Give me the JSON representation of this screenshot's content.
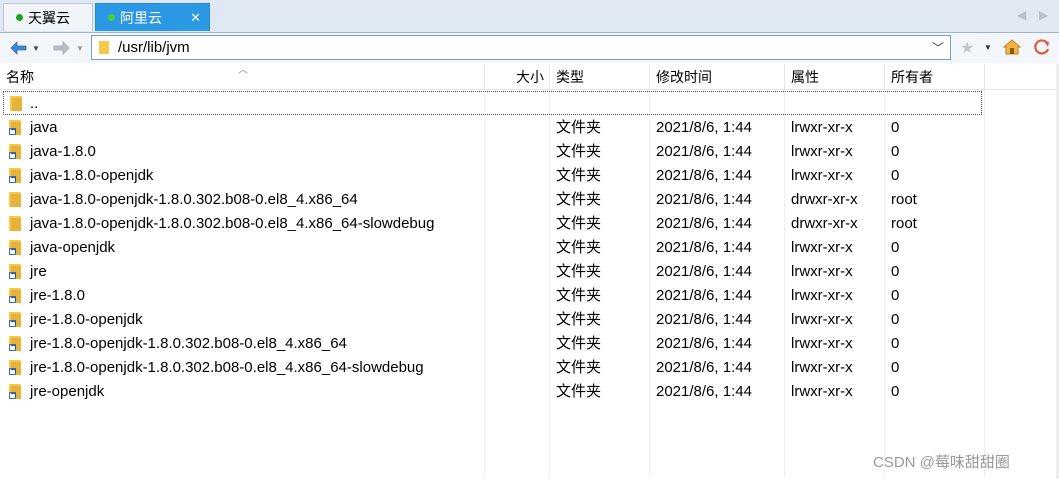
{
  "tabs": [
    {
      "label": "天翼云",
      "active": false
    },
    {
      "label": "阿里云",
      "active": true
    }
  ],
  "address": {
    "path": "/usr/lib/jvm"
  },
  "columns": [
    "名称",
    "大小",
    "类型",
    "修改时间",
    "属性",
    "所有者"
  ],
  "up_label": "..",
  "rows": [
    {
      "name": "java",
      "type": "文件夹",
      "modified": "2021/8/6, 1:44",
      "perms": "lrwxr-xr-x",
      "owner": "0",
      "link": true
    },
    {
      "name": "java-1.8.0",
      "type": "文件夹",
      "modified": "2021/8/6, 1:44",
      "perms": "lrwxr-xr-x",
      "owner": "0",
      "link": true
    },
    {
      "name": "java-1.8.0-openjdk",
      "type": "文件夹",
      "modified": "2021/8/6, 1:44",
      "perms": "lrwxr-xr-x",
      "owner": "0",
      "link": true
    },
    {
      "name": "java-1.8.0-openjdk-1.8.0.302.b08-0.el8_4.x86_64",
      "type": "文件夹",
      "modified": "2021/8/6, 1:44",
      "perms": "drwxr-xr-x",
      "owner": "root",
      "link": false
    },
    {
      "name": "java-1.8.0-openjdk-1.8.0.302.b08-0.el8_4.x86_64-slowdebug",
      "type": "文件夹",
      "modified": "2021/8/6, 1:44",
      "perms": "drwxr-xr-x",
      "owner": "root",
      "link": false
    },
    {
      "name": "java-openjdk",
      "type": "文件夹",
      "modified": "2021/8/6, 1:44",
      "perms": "lrwxr-xr-x",
      "owner": "0",
      "link": true
    },
    {
      "name": "jre",
      "type": "文件夹",
      "modified": "2021/8/6, 1:44",
      "perms": "lrwxr-xr-x",
      "owner": "0",
      "link": true
    },
    {
      "name": "jre-1.8.0",
      "type": "文件夹",
      "modified": "2021/8/6, 1:44",
      "perms": "lrwxr-xr-x",
      "owner": "0",
      "link": true
    },
    {
      "name": "jre-1.8.0-openjdk",
      "type": "文件夹",
      "modified": "2021/8/6, 1:44",
      "perms": "lrwxr-xr-x",
      "owner": "0",
      "link": true
    },
    {
      "name": "jre-1.8.0-openjdk-1.8.0.302.b08-0.el8_4.x86_64",
      "type": "文件夹",
      "modified": "2021/8/6, 1:44",
      "perms": "lrwxr-xr-x",
      "owner": "0",
      "link": true
    },
    {
      "name": "jre-1.8.0-openjdk-1.8.0.302.b08-0.el8_4.x86_64-slowdebug",
      "type": "文件夹",
      "modified": "2021/8/6, 1:44",
      "perms": "lrwxr-xr-x",
      "owner": "0",
      "link": true
    },
    {
      "name": "jre-openjdk",
      "type": "文件夹",
      "modified": "2021/8/6, 1:44",
      "perms": "lrwxr-xr-x",
      "owner": "0",
      "link": true
    }
  ],
  "watermark": "CSDN @莓味甜甜圈",
  "colors": {
    "active_tab": "#2a98e3",
    "status_dot": "#1fa31f",
    "folder": "#f5c94b"
  }
}
